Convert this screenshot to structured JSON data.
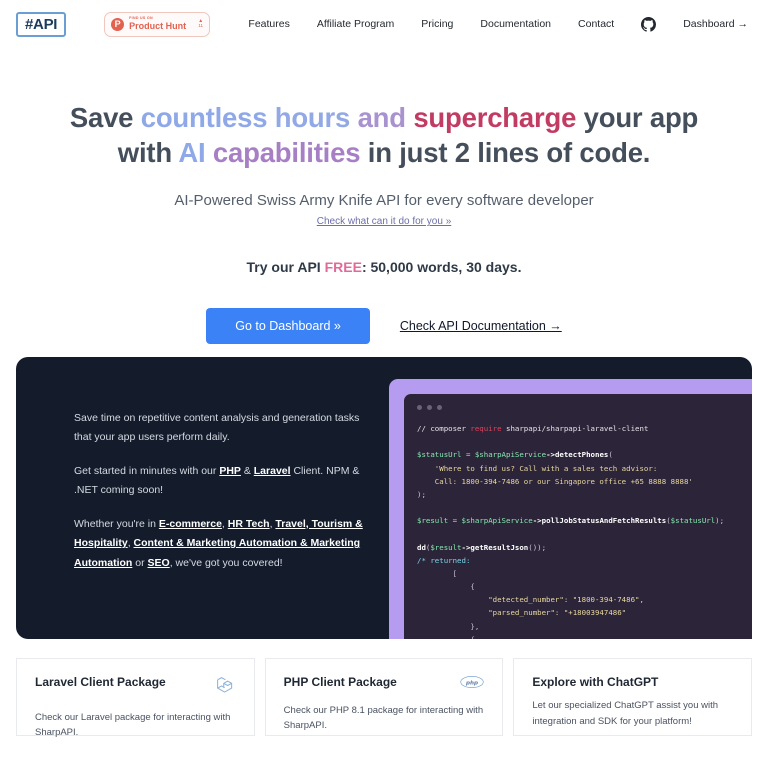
{
  "nav": {
    "logo": "#API",
    "product_hunt": {
      "small_text": "FIND US ON",
      "name": "Product Hunt",
      "caret": "▲",
      "count": "11"
    },
    "links": [
      {
        "label": "Features"
      },
      {
        "label": "Affiliate Program"
      },
      {
        "label": "Pricing"
      },
      {
        "label": "Documentation"
      },
      {
        "label": "Contact"
      }
    ],
    "github_icon": "github-icon",
    "dashboard_label": "Dashboard →"
  },
  "hero": {
    "headline": {
      "l1_p1": "Save ",
      "l1_p2": "countless",
      "l1_p3": " hours",
      "l1_p4": " and ",
      "l1_p5": "supercharge",
      "l1_p6": " your app",
      "l2_p1": "with ",
      "l2_p2": "AI",
      "l2_p3": " capabilities",
      "l2_p4": " in just 2 lines of code."
    },
    "subheadline": "AI-Powered Swiss Army Knife API for every software developer",
    "sub_link": "Check what can it do for you »",
    "try_prefix": "Try our API ",
    "try_free": "FREE",
    "try_suffix": ": 50,000 words, 30 days.",
    "primary_button": "Go to Dashboard »",
    "doc_link": "Check API Documentation →"
  },
  "panel": {
    "p1": "Save time on repetitive content analysis and generation tasks that your app users perform daily.",
    "p2_pre": "Get started in minutes with our ",
    "p2_php": "PHP",
    "p2_amp": " & ",
    "p2_laravel": "Laravel",
    "p2_post": " Client. NPM & .NET coming soon!",
    "p3_pre": "Whether you're in ",
    "p3_tags": [
      "E-commerce",
      "HR Tech",
      "Travel, Tourism & Hospitality",
      "Content & Marketing Automation & Marketing Automation",
      "SEO"
    ],
    "p3_or": " or ",
    "p3_post": ", we've got you covered!"
  },
  "code": {
    "window_dots": 3,
    "lines": [
      "// composer require sharpapi/sharpapi-laravel-client",
      "",
      "$statusUrl = $sharpApiService->detectPhones(",
      "    'Where to find us? Call with a sales tech advisor:",
      "    Call: 1800-394-7486 or our Singapore office +65 8888 8888'",
      ");",
      "",
      "$result = $sharpApiService->pollJobStatusAndFetchResults($statusUrl);",
      "",
      "dd($result->getResultJson());",
      "/* returned:",
      "        [",
      "            {",
      "                \"detected_number\": \"1800-394-7486\",",
      "                \"parsed_number\": \"+18003947486\"",
      "            },",
      "            {"
    ]
  },
  "cards": [
    {
      "title": "Laravel Client Package",
      "desc": "Check our Laravel package for interacting with SharpAPI.",
      "icon": "laravel-icon"
    },
    {
      "title": "PHP Client Package",
      "desc": "Check our PHP 8.1 package for interacting with SharpAPI.",
      "icon": "php-icon"
    },
    {
      "title": "Explore with ChatGPT",
      "desc": "Let our specialized ChatGPT assist you with integration and SDK for your platform!",
      "icon": "none"
    }
  ],
  "colors": {
    "accent_blue": "#3b82f6",
    "dark_panel": "#141c2c",
    "code_bg": "#2c2438",
    "code_frame": "#b69cf0",
    "product_hunt": "#e3614f",
    "free_pink": "#e06a9a"
  }
}
